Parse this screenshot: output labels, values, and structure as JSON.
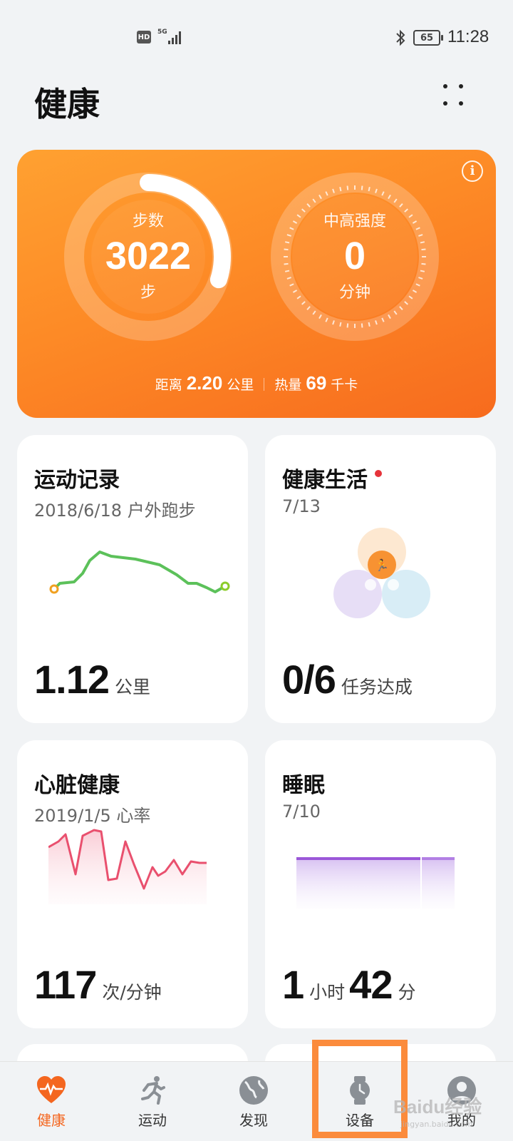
{
  "status_bar": {
    "hd": "HD",
    "network": "5G",
    "battery": "65",
    "time": "11:28"
  },
  "header": {
    "title": "健康"
  },
  "activity": {
    "steps_label": "步数",
    "steps_value": "3022",
    "steps_unit": "步",
    "steps_progress": 0.3,
    "intensity_label": "中高强度",
    "intensity_value": "0",
    "intensity_unit": "分钟",
    "distance_label": "距离",
    "distance_value": "2.20",
    "distance_unit": "公里",
    "calories_label": "热量",
    "calories_value": "69",
    "calories_unit": "千卡",
    "colors": {
      "gradient_start": "#ffa131",
      "gradient_end": "#f76b1e"
    }
  },
  "cards": {
    "exercise": {
      "title": "运动记录",
      "subtitle": "2018/6/18 户外跑步",
      "value": "1.12",
      "unit": "公里"
    },
    "healthy_living": {
      "title": "健康生活",
      "subtitle": "7/13",
      "value": "0/6",
      "unit": "任务达成",
      "has_badge": true
    },
    "heart": {
      "title": "心脏健康",
      "subtitle": "2019/1/5 心率",
      "value": "117",
      "unit": "次/分钟"
    },
    "sleep": {
      "title": "睡眠",
      "subtitle": "7/10",
      "hours": "1",
      "hours_unit": "小时",
      "minutes": "42",
      "minutes_unit": "分"
    }
  },
  "bottom_nav": {
    "items": [
      {
        "label": "健康",
        "icon": "heart-pulse-icon",
        "active": true
      },
      {
        "label": "运动",
        "icon": "running-icon",
        "active": false
      },
      {
        "label": "发现",
        "icon": "globe-icon",
        "active": false
      },
      {
        "label": "设备",
        "icon": "watch-icon",
        "active": false
      },
      {
        "label": "我的",
        "icon": "profile-icon",
        "active": false
      }
    ],
    "accent": "#f4661f"
  },
  "watermark": {
    "brand": "Baidu经验",
    "url": "jingyan.baidu.com"
  }
}
